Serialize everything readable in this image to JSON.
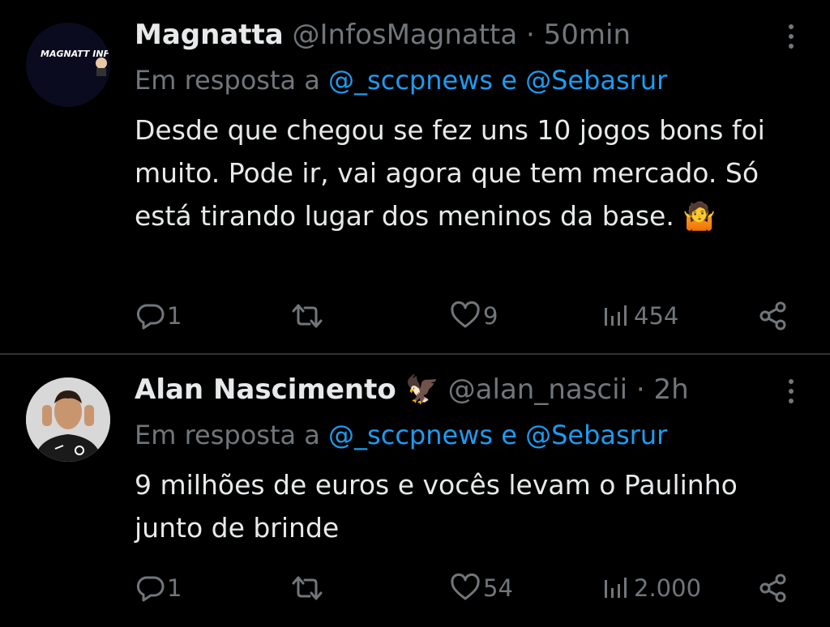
{
  "tweets": [
    {
      "name": "Magnatta",
      "handle": "@InfosMagnatta",
      "sep": "·",
      "time": "50min",
      "reply_prefix": "Em resposta a",
      "reply_to": "@_sccpnews e @Sebasrur",
      "avatar_text": "MAGNATT INFO",
      "text": "Desde que chegou se fez uns 10 jogos bons foi muito. Pode ir, vai agora que tem mercado. Só está tirando lugar dos meninos da base. 🤷",
      "stats": {
        "replies": "1",
        "reposts": "",
        "likes": "9",
        "views": "454"
      }
    },
    {
      "name": "Alan Nascimento",
      "name_emoji": "🦅",
      "handle": "@alan_nascii",
      "sep": "·",
      "time": "2h",
      "reply_prefix": "Em resposta a",
      "reply_to": "@_sccpnews e @Sebasrur",
      "text": "9 milhões de euros e vocês levam o Paulinho junto de brinde",
      "stats": {
        "replies": "1",
        "reposts": "",
        "likes": "54",
        "views": "2.000"
      }
    }
  ],
  "colors": {
    "background": "#000000",
    "text": "#e7e9ea",
    "muted": "#71767b",
    "accent": "#1d9bf0",
    "divider": "#2f3336"
  },
  "icons": [
    "more-icon",
    "reply-icon",
    "repost-icon",
    "like-icon",
    "views-icon",
    "share-icon"
  ]
}
